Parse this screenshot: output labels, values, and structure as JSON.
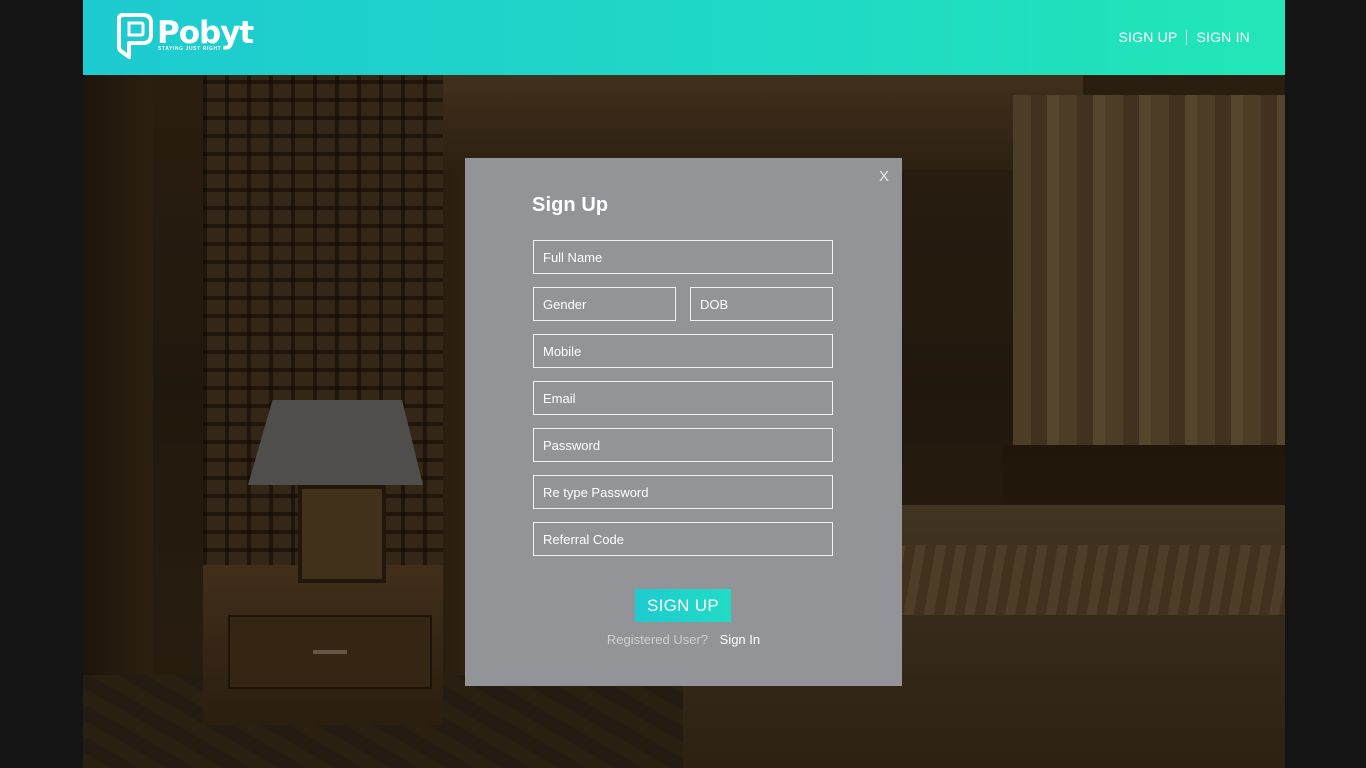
{
  "brand": {
    "name": "Pobyt",
    "tagline": "STAYING JUST RIGHT",
    "accent_start": "#1ecbd0",
    "accent_end": "#22e6b7"
  },
  "header": {
    "nav": {
      "signup_label": "SIGN UP",
      "signin_label": "SIGN IN"
    }
  },
  "modal": {
    "close_label": "X",
    "title": "Sign Up",
    "fields": {
      "full_name": {
        "placeholder": "Full Name",
        "value": ""
      },
      "gender": {
        "placeholder": "Gender",
        "value": ""
      },
      "dob": {
        "placeholder": "DOB",
        "value": ""
      },
      "mobile": {
        "placeholder": "Mobile",
        "value": ""
      },
      "email": {
        "placeholder": "Email",
        "value": ""
      },
      "password": {
        "placeholder": "Password",
        "value": ""
      },
      "retype_password": {
        "placeholder": "Re type Password",
        "value": ""
      },
      "referral_code": {
        "placeholder": "Referral Code",
        "value": ""
      }
    },
    "submit_label": "SIGN UP",
    "registered_question": "Registered User?",
    "signin_link_label": "Sign In",
    "background_color": "#939498"
  },
  "icons": {
    "logo": "logo-icon",
    "close": "close-icon"
  }
}
